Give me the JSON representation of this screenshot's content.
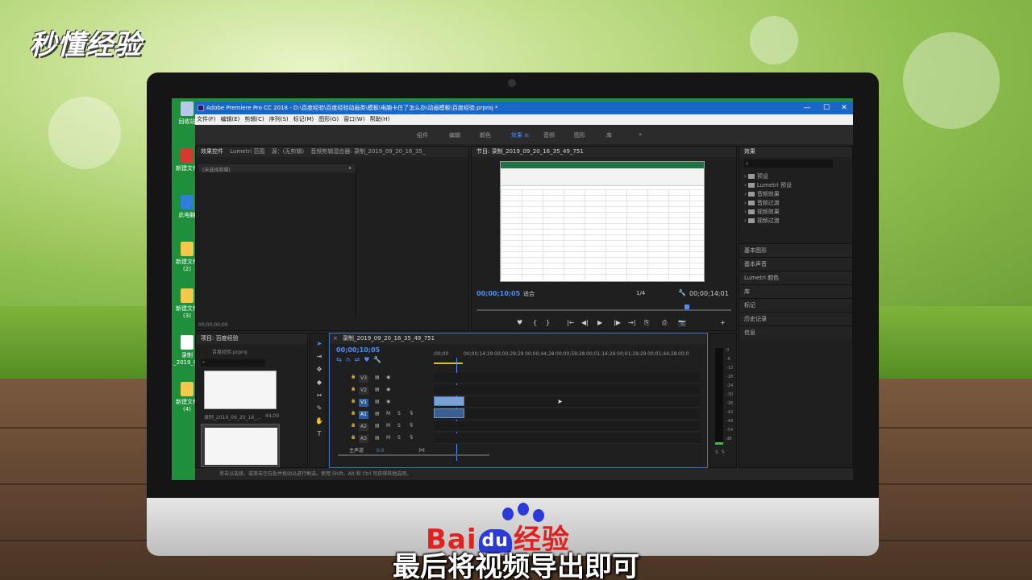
{
  "watermark": {
    "logo_text": "秒懂经验"
  },
  "desktop": {
    "icons": [
      "回收站",
      "新建文件",
      "此电脑",
      "新建文件(2)",
      "新建文件(3)",
      "录制_2019_09",
      "新建文件(4)"
    ]
  },
  "app": {
    "title": "Adobe Premiere Pro CC 2018 - D:\\百度经验\\百度经验动画类\\模板\\电脑卡住了怎么办\\动画模板\\百度经验.prproj *",
    "menus": [
      "文件(F)",
      "编辑(E)",
      "剪辑(C)",
      "序列(S)",
      "标记(M)",
      "图形(G)",
      "窗口(W)",
      "帮助(H)"
    ],
    "window_controls": {
      "minimize": "—",
      "maximize": "☐",
      "close": "✕"
    },
    "workspaces": [
      "组件",
      "编辑",
      "颜色",
      "效果",
      "音频",
      "图形",
      "库",
      "»"
    ],
    "active_workspace": "效果"
  },
  "source_panel": {
    "tabs": [
      "效果控件",
      "Lumetri 范围",
      "源：(无剪辑)",
      "音频剪辑混合器: 录制_2019_09_20_16_35_"
    ],
    "no_clip": "(未选择剪辑)",
    "timecode": "00;00;00;00"
  },
  "program_panel": {
    "title": "节目: 录制_2019_09_20_16_35_49_751",
    "timecode_left": "00;00;10;05",
    "fit": "适合",
    "resolution": "1/4",
    "timecode_right": "00;00;14;01",
    "controls": [
      "♥",
      "{",
      "}",
      "|←",
      "◀|",
      "▶",
      "|▶",
      "→|",
      "⎘",
      "⎙",
      "📷",
      "+"
    ],
    "playhead": 0.81
  },
  "effects_panel": {
    "title": "效果",
    "items": [
      "预设",
      "Lumetri 预设",
      "音频效果",
      "音频过渡",
      "视频效果",
      "视频过渡"
    ],
    "sections": [
      "基本图形",
      "基本声音",
      "Lumetri 颜色",
      "库",
      "标记",
      "历史记录",
      "信息"
    ]
  },
  "project_panel": {
    "title": "项目: 百度经验",
    "file": "百度经验.prproj",
    "clip_name": "录制_2019_09_20_16_...",
    "clip_duration": "44;00"
  },
  "timeline": {
    "title": "录制_2019_09_20_16_35_49_751",
    "timecode": "00;00;10;05",
    "ruler": [
      ";00;00",
      "00;00;14;29",
      "00;00;29;29",
      "00;00;44;28",
      "00;00;59;28",
      "00;01;14;29",
      "00;01;29;29",
      "00;01;44;28",
      "00;0"
    ],
    "video_tracks": [
      "V3",
      "V2",
      "V1"
    ],
    "audio_tracks": [
      "A1",
      "A2",
      "A3"
    ],
    "master": "主声道",
    "master_value": "0.0",
    "track_letters": {
      "mute": "M",
      "solo": "S"
    }
  },
  "meter": {
    "labels": [
      "0",
      "-6",
      "-12",
      "-18",
      "-24",
      "-30",
      "-36",
      "-42",
      "-48",
      "-54",
      "dB"
    ],
    "solo": [
      "S",
      "S"
    ]
  },
  "status_bar": "单击以选择，或单击空白处并拖动以进行框选。使用 Shift、Alt 和 Ctrl 可获得其他选项。",
  "subtitle": "最后将视频导出即可",
  "footer_logo": "Bai经验",
  "footer_logo_du": "du"
}
